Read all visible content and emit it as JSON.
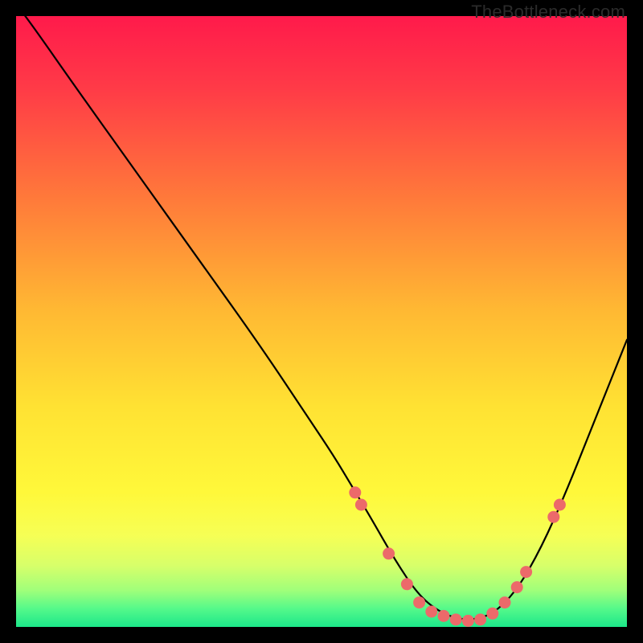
{
  "watermark": "TheBottleneck.com",
  "chart_data": {
    "type": "line",
    "title": "",
    "xlabel": "",
    "ylabel": "",
    "xlim": [
      0,
      100
    ],
    "ylim": [
      0,
      100
    ],
    "series": [
      {
        "name": "bottleneck-curve",
        "x": [
          0,
          3,
          10,
          20,
          30,
          40,
          48,
          52,
          55,
          58,
          62,
          66,
          70,
          74,
          78,
          82,
          86,
          90,
          94,
          98,
          100
        ],
        "y": [
          102,
          98,
          88,
          74,
          60,
          46,
          34,
          28,
          23,
          18,
          11,
          5,
          2,
          1,
          2,
          6,
          13,
          22,
          32,
          42,
          47
        ]
      }
    ],
    "markers": {
      "name": "highlight-dots",
      "color": "#ec6a6a",
      "points": [
        {
          "x": 55.5,
          "y": 22
        },
        {
          "x": 56.5,
          "y": 20
        },
        {
          "x": 61.0,
          "y": 12
        },
        {
          "x": 64.0,
          "y": 7
        },
        {
          "x": 66.0,
          "y": 4
        },
        {
          "x": 68.0,
          "y": 2.5
        },
        {
          "x": 70.0,
          "y": 1.8
        },
        {
          "x": 72.0,
          "y": 1.2
        },
        {
          "x": 74.0,
          "y": 1.0
        },
        {
          "x": 76.0,
          "y": 1.2
        },
        {
          "x": 78.0,
          "y": 2.2
        },
        {
          "x": 80.0,
          "y": 4.0
        },
        {
          "x": 82.0,
          "y": 6.5
        },
        {
          "x": 83.5,
          "y": 9.0
        },
        {
          "x": 88.0,
          "y": 18
        },
        {
          "x": 89.0,
          "y": 20
        }
      ]
    },
    "gradient_stops": [
      {
        "offset": 0,
        "color": "#ff1a4b"
      },
      {
        "offset": 12,
        "color": "#ff3b47"
      },
      {
        "offset": 30,
        "color": "#ff7a3a"
      },
      {
        "offset": 48,
        "color": "#ffb833"
      },
      {
        "offset": 64,
        "color": "#ffe233"
      },
      {
        "offset": 78,
        "color": "#fff83a"
      },
      {
        "offset": 85,
        "color": "#f6ff55"
      },
      {
        "offset": 90,
        "color": "#d7ff6a"
      },
      {
        "offset": 94,
        "color": "#a0ff7a"
      },
      {
        "offset": 97,
        "color": "#55f98a"
      },
      {
        "offset": 100,
        "color": "#1ce78a"
      }
    ]
  }
}
